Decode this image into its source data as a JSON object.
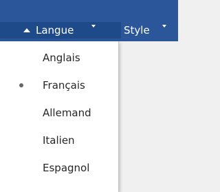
{
  "toolbar": {
    "langue_label": "Langue",
    "style_label": "Style"
  },
  "menu": {
    "items": [
      {
        "label": "Anglais",
        "selected": false
      },
      {
        "label": "Français",
        "selected": true
      },
      {
        "label": "Allemand",
        "selected": false
      },
      {
        "label": "Italien",
        "selected": false
      },
      {
        "label": "Espagnol",
        "selected": false
      }
    ]
  },
  "colors": {
    "toolbar_bg": "#2b579a",
    "active_tab_bg": "#1e4a8a",
    "menu_bg": "#ffffff",
    "text": "#262626"
  }
}
